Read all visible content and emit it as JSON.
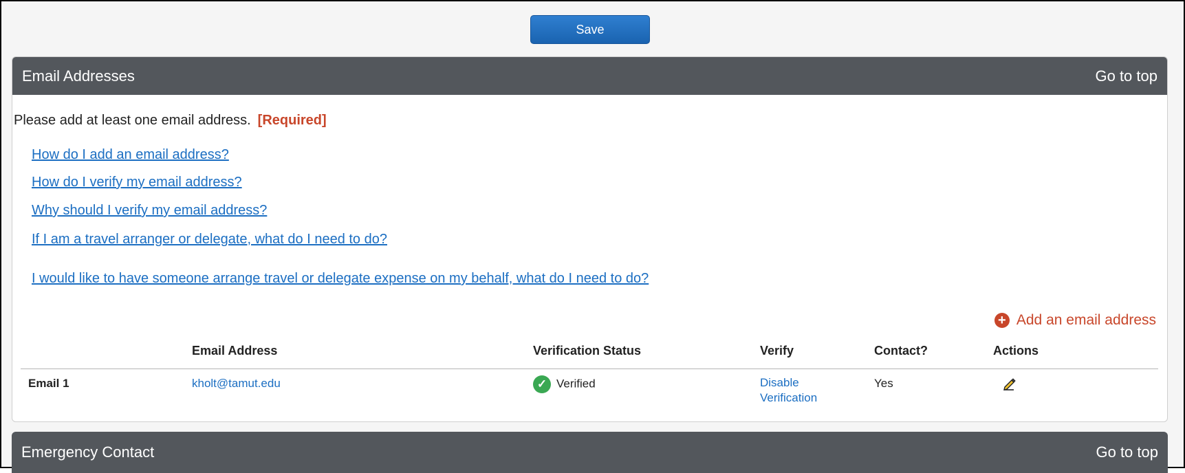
{
  "toolbar": {
    "save_label": "Save"
  },
  "email_section": {
    "title": "Email Addresses",
    "go_to_top": "Go to top",
    "required_text": "Please add at least one email address.",
    "required_badge": "[Required]",
    "help_links": [
      "How do I add an email address?",
      "How do I verify my email address?",
      "Why should I verify my email address?",
      "If I am a travel arranger or delegate, what do I need to do?",
      "I would like to have someone arrange travel or delegate expense on my behalf, what do I need to do?"
    ],
    "add_email_label": "Add an email address",
    "table": {
      "headers": {
        "email_address": "Email Address",
        "verification_status": "Verification Status",
        "verify": "Verify",
        "contact": "Contact?",
        "actions": "Actions"
      },
      "rows": [
        {
          "label": "Email 1",
          "email": "kholt@tamut.edu",
          "status": "Verified",
          "verify_line1": "Disable",
          "verify_line2": "Verification",
          "contact": "Yes"
        }
      ]
    }
  },
  "emergency_section": {
    "title": "Emergency Contact",
    "go_to_top": "Go to top"
  },
  "colors": {
    "header_bg": "#53575c",
    "accent_blue": "#1b6ec2",
    "required_red": "#c8462a",
    "verified_green": "#3aa853"
  },
  "icons": {
    "add": "plus-circle-icon",
    "verified": "check-circle-icon",
    "edit": "pencil-icon"
  }
}
